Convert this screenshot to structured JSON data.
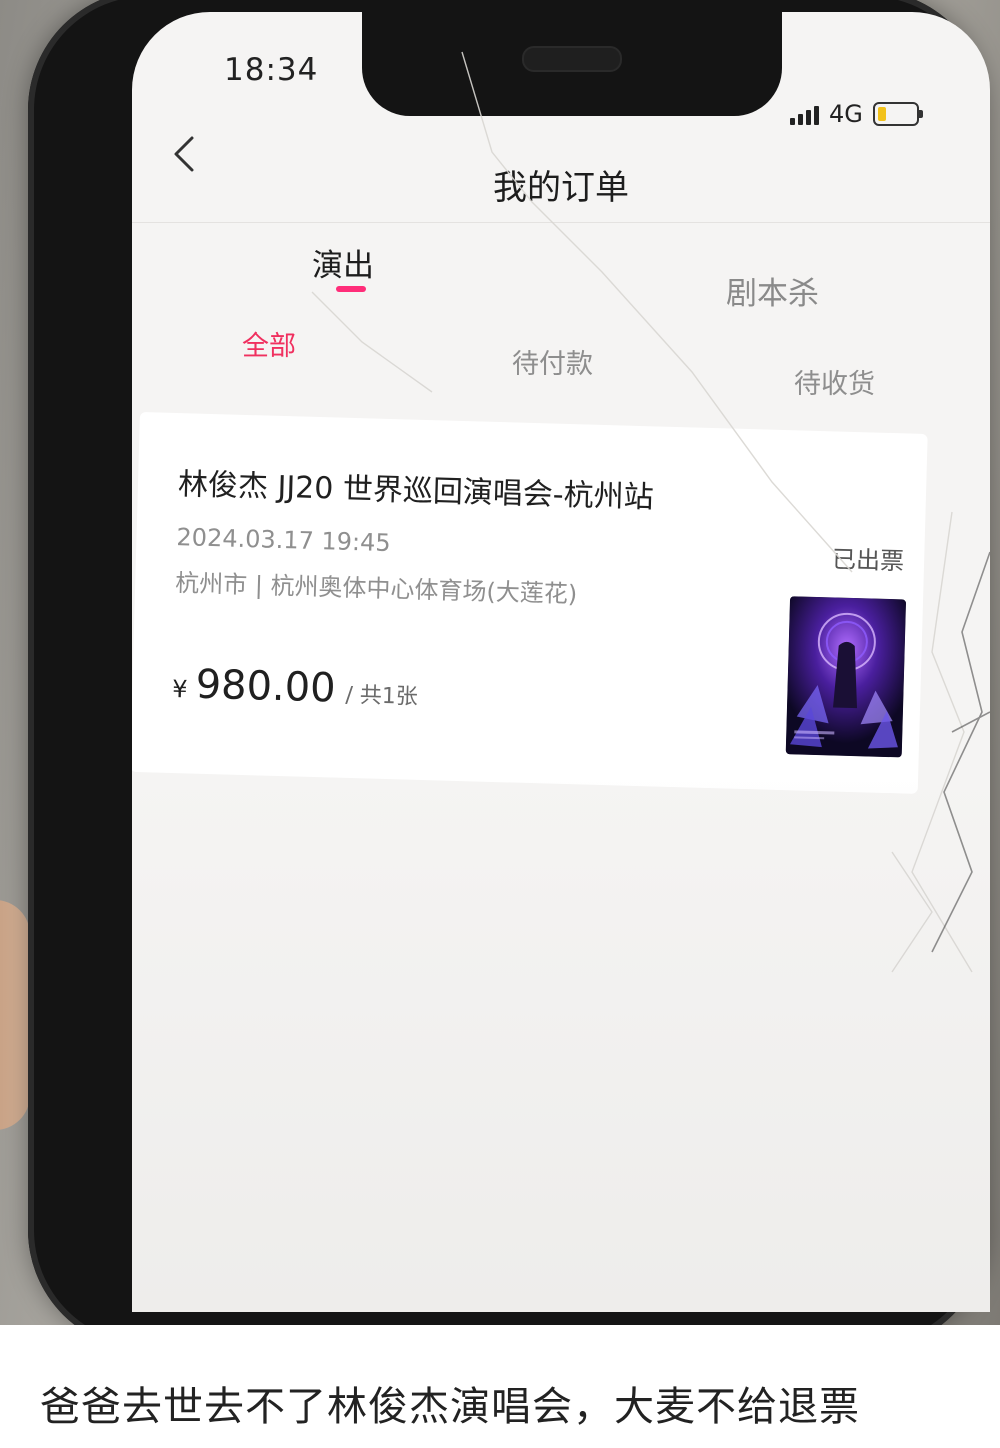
{
  "status_bar": {
    "time": "18:34",
    "network": "4G"
  },
  "header": {
    "title": "我的订单"
  },
  "tabs": [
    {
      "label": "演出",
      "active": true
    },
    {
      "label": "剧本杀",
      "active": false
    }
  ],
  "subtabs": [
    {
      "label": "全部",
      "active": true
    },
    {
      "label": "待付款",
      "active": false
    },
    {
      "label": "待收货",
      "active": false
    }
  ],
  "order": {
    "title": "林俊杰 JJ20 世界巡回演唱会-杭州站",
    "datetime": "2024.03.17 19:45",
    "venue": "杭州市 | 杭州奥体中心体育场(大莲花)",
    "status": "已出票",
    "currency": "¥",
    "price": "980.00",
    "quantity": "/ 共1张"
  },
  "caption": "爸爸去世去不了林俊杰演唱会，大麦不给退票",
  "colors": {
    "accent_pink": "#ff2d79",
    "active_red": "#f0305f",
    "battery_yellow": "#f2c21b"
  },
  "icons": [
    "back-chevron-icon",
    "signal-icon",
    "battery-icon"
  ]
}
